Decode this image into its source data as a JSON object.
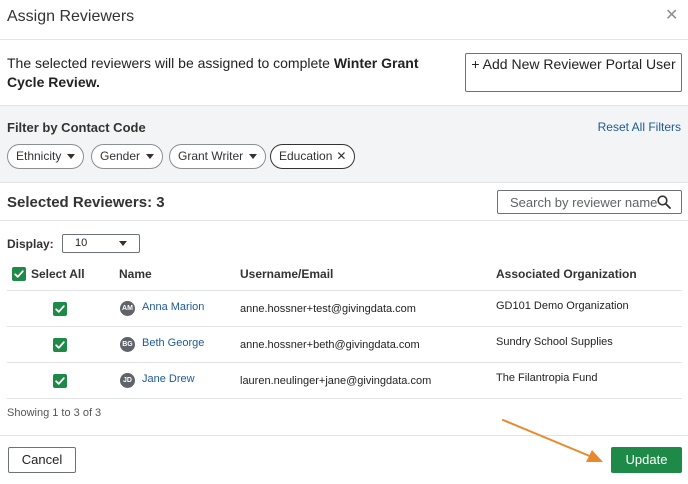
{
  "dialog": {
    "title": "Assign Reviewers",
    "close_icon": "close-icon"
  },
  "intro": {
    "text_before": "The selected reviewers will be assigned to complete ",
    "bold_text": "Winter Grant Cycle Review.",
    "add_button_label": "+ Add New Reviewer Portal User"
  },
  "filter": {
    "title": "Filter by Contact Code",
    "reset_label": "Reset All Filters",
    "chips": [
      {
        "label": "Ethnicity",
        "type": "dropdown"
      },
      {
        "label": "Gender",
        "type": "dropdown"
      },
      {
        "label": "Grant Writer",
        "type": "dropdown"
      },
      {
        "label": "Education",
        "type": "removable"
      }
    ]
  },
  "selected": {
    "title": "Selected Reviewers: 3",
    "search_placeholder": "Search by reviewer name"
  },
  "display": {
    "label": "Display:",
    "value": "10"
  },
  "table": {
    "headers": {
      "select_all": "Select All",
      "name": "Name",
      "email": "Username/Email",
      "org": "Associated Organization"
    },
    "rows": [
      {
        "initials": "AM",
        "name": "Anna Marion",
        "email": "anne.hossner+test@givingdata.com",
        "org": "GD101 Demo Organization",
        "checked": true
      },
      {
        "initials": "BG",
        "name": "Beth George",
        "email": "anne.hossner+beth@givingdata.com",
        "org": "Sundry School Supplies",
        "checked": true
      },
      {
        "initials": "JD",
        "name": "Jane Drew",
        "email": "lauren.neulinger+jane@givingdata.com",
        "org": "The Filantropia Fund",
        "checked": true
      }
    ],
    "showing": "Showing 1 to 3 of 3"
  },
  "footer": {
    "cancel_label": "Cancel",
    "update_label": "Update"
  },
  "colors": {
    "accent_green": "#1e8a47",
    "link_blue": "#1d5a96",
    "annotation_arrow": "#e8892c"
  }
}
